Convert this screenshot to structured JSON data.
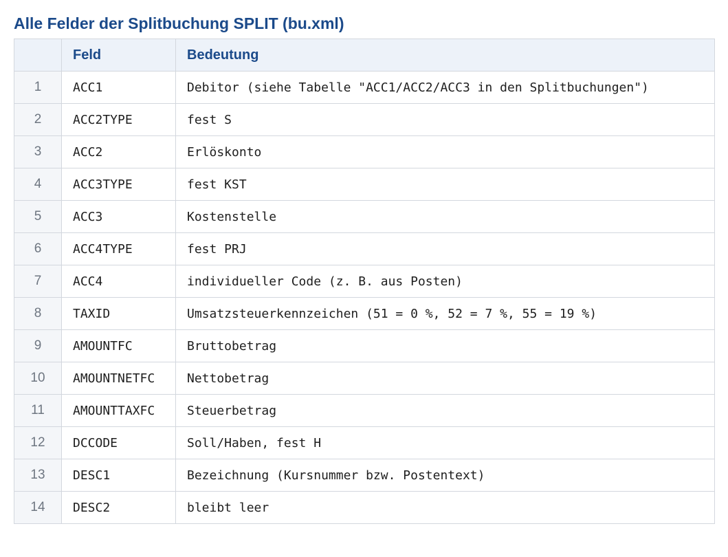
{
  "title": "Alle Felder der Splitbuchung SPLIT (bu.xml)",
  "table": {
    "headers": {
      "index": "",
      "feld": "Feld",
      "bedeutung": "Bedeutung"
    },
    "rows": [
      {
        "index": "1",
        "feld": "ACC1",
        "bedeutung": "Debitor (siehe Tabelle \"ACC1/ACC2/ACC3 in den Splitbuchungen\")"
      },
      {
        "index": "2",
        "feld": "ACC2TYPE",
        "bedeutung": "fest S"
      },
      {
        "index": "3",
        "feld": "ACC2",
        "bedeutung": "Erlöskonto"
      },
      {
        "index": "4",
        "feld": "ACC3TYPE",
        "bedeutung": "fest KST"
      },
      {
        "index": "5",
        "feld": "ACC3",
        "bedeutung": "Kostenstelle"
      },
      {
        "index": "6",
        "feld": "ACC4TYPE",
        "bedeutung": "fest PRJ"
      },
      {
        "index": "7",
        "feld": "ACC4",
        "bedeutung": "individueller Code (z. B. aus Posten)"
      },
      {
        "index": "8",
        "feld": "TAXID",
        "bedeutung": "Umsatzsteuerkennzeichen (51 = 0 %, 52 = 7 %, 55 = 19 %)"
      },
      {
        "index": "9",
        "feld": "AMOUNTFC",
        "bedeutung": "Bruttobetrag"
      },
      {
        "index": "10",
        "feld": "AMOUNTNETFC",
        "bedeutung": "Nettobetrag"
      },
      {
        "index": "11",
        "feld": "AMOUNTTAXFC",
        "bedeutung": "Steuerbetrag"
      },
      {
        "index": "12",
        "feld": "DCCODE",
        "bedeutung": "Soll/Haben, fest H"
      },
      {
        "index": "13",
        "feld": "DESC1",
        "bedeutung": "Bezeichnung (Kursnummer bzw. Postentext)"
      },
      {
        "index": "14",
        "feld": "DESC2",
        "bedeutung": "bleibt leer"
      }
    ]
  },
  "colors": {
    "accent": "#1b4a8a",
    "header_bg": "#edf2f9",
    "index_bg": "#f4f6f9",
    "border": "#d3d7de"
  }
}
